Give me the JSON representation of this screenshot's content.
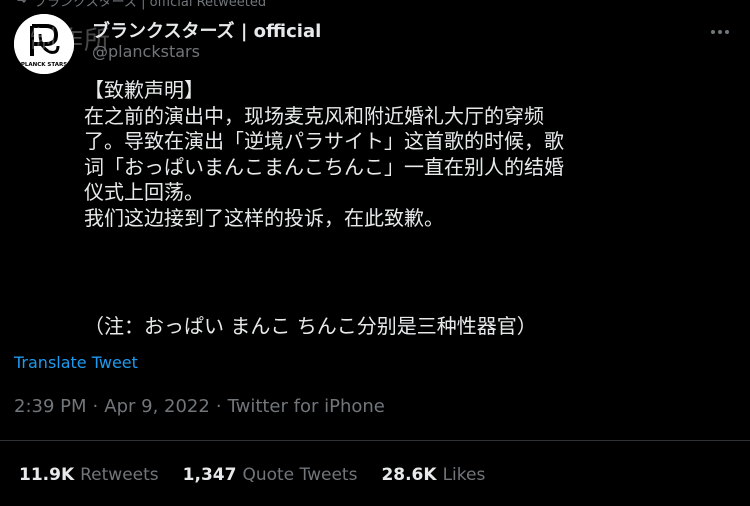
{
  "retweet_banner": "ブランクスターズ | official Retweeted",
  "watermark": "制作所",
  "author": {
    "display_name": "ブランクスターズ | official",
    "handle": "@planckstars",
    "avatar_text": "PLANCK STARS"
  },
  "tweet": {
    "title": "【致歉声明】",
    "lines": [
      "在之前的演出中，现场麦克风和附近婚礼大厅的穿频",
      "了。导致在演出「逆境パラサイト」这首歌的时候，歌",
      "词「おっぱいまんこまんこちんこ」一直在别人的结婚",
      "仪式上回荡。",
      "我们这边接到了这样的投诉，在此致歉。"
    ],
    "note": "（注：おっぱい まんこ ちんこ分别是三种性器官）"
  },
  "translate_label": "Translate Tweet",
  "meta": {
    "time": "2:39 PM",
    "sep1": "·",
    "date": "Apr 9, 2022",
    "sep2": "·",
    "source": "Twitter for iPhone"
  },
  "stats": [
    {
      "count": "11.9K",
      "label": "Retweets"
    },
    {
      "count": "1,347",
      "label": "Quote Tweets"
    },
    {
      "count": "28.6K",
      "label": "Likes"
    }
  ],
  "colors": {
    "background": "#000000",
    "text": "#e7e9ea",
    "muted": "#71767b",
    "link": "#1d9bf0"
  }
}
